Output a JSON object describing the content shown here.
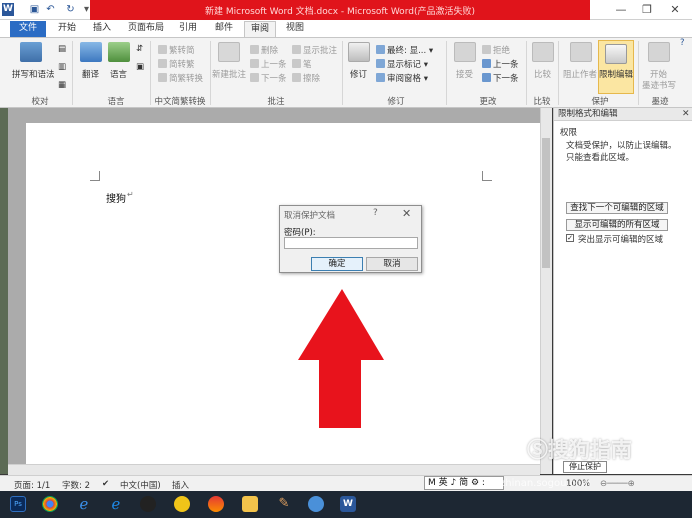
{
  "window": {
    "title": "新建 Microsoft Word 文档.docx - Microsoft Word(产品激活失败)",
    "app_icon": "W",
    "minimize": "—",
    "restore": "❐",
    "close": "✕"
  },
  "tabs": [
    "文件",
    "开始",
    "插入",
    "页面布局",
    "引用",
    "邮件",
    "审阅",
    "视图"
  ],
  "ribbon": {
    "groups": {
      "proofing": "校对",
      "language": "语言",
      "chinese": "中文简繁转换",
      "comments": "批注",
      "tracking": "修订",
      "changes": "更改",
      "compare": "比较",
      "protect": "保护",
      "ink": "墨迹"
    },
    "items": {
      "spelling": "拼写和语法",
      "translate": "翻译",
      "language": "语言",
      "to_trad": "繁转简",
      "to_simp": "简转繁",
      "convert": "简繁转换",
      "new_comment": "新建批注",
      "delete": "删除",
      "previous": "上一条",
      "next": "下一条",
      "show_comments": "显示批注",
      "pen": "笔",
      "eraser": "擦除",
      "track": "修订",
      "final": "最终: 显...",
      "show_markup": "显示标记",
      "review_pane": "审阅窗格",
      "accept": "接受",
      "reject": "拒绝",
      "prev_change": "上一条",
      "next_change": "下一条",
      "compare": "比较",
      "block_authors": "阻止作者",
      "restrict": "限制编辑",
      "start_ink": "开始",
      "start_ink2": "墨迹书写"
    }
  },
  "document": {
    "text": "搜狗"
  },
  "dialog": {
    "title": "取消保护文档",
    "help": "?",
    "close": "✕",
    "password_label": "密码(P):",
    "password_value": "",
    "ok": "确定",
    "cancel": "取消"
  },
  "pane": {
    "title": "限制格式和编辑",
    "close": "✕",
    "permission_header": "权限",
    "line1": "文档受保护，以防止误编辑。",
    "line2": "只能查看此区域。",
    "find_next": "查找下一个可编辑的区域",
    "show_all": "显示可编辑的所有区域",
    "highlight_label": "突出显示可编辑的区域",
    "stop_protection": "停止保护"
  },
  "status": {
    "page": "页面: 1/1",
    "words": "字数: 2",
    "language": "中文(中国)",
    "mode": "插入",
    "zoom": "100%"
  },
  "ime": "M 英 ♪ 简 ⚙ :",
  "watermark": {
    "main": "搜狗指南",
    "sub": "zhinan.sogou.com"
  },
  "colors": {
    "title_red": "#e0141b",
    "file_tab": "#2b6cc4",
    "arrow": "#e8131c",
    "highlight_btn": "#fbe6a2"
  }
}
